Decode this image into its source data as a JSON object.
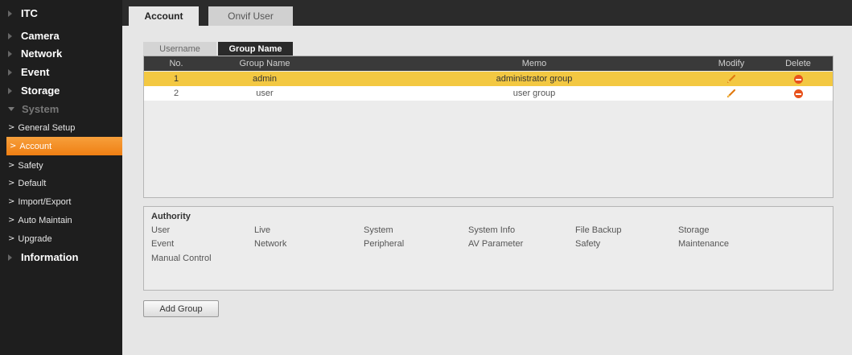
{
  "sidebar": {
    "items": [
      {
        "label": "ITC",
        "type": "top",
        "expanded": false
      },
      {
        "label": "Camera",
        "type": "top",
        "expanded": false
      },
      {
        "label": "Network",
        "type": "top",
        "expanded": false
      },
      {
        "label": "Event",
        "type": "top",
        "expanded": false
      },
      {
        "label": "Storage",
        "type": "top",
        "expanded": false
      },
      {
        "label": "System",
        "type": "top",
        "expanded": true
      },
      {
        "label": "General Setup",
        "type": "sub"
      },
      {
        "label": "Account",
        "type": "sub",
        "active": true
      },
      {
        "label": "Safety",
        "type": "sub"
      },
      {
        "label": "Default",
        "type": "sub"
      },
      {
        "label": "Import/Export",
        "type": "sub"
      },
      {
        "label": "Auto Maintain",
        "type": "sub"
      },
      {
        "label": "Upgrade",
        "type": "sub"
      },
      {
        "label": "Information",
        "type": "top",
        "expanded": false
      }
    ]
  },
  "tabs": {
    "account": "Account",
    "onvif": "Onvif User"
  },
  "subtabs": {
    "username": "Username",
    "group_name": "Group Name"
  },
  "table": {
    "headers": {
      "no": "No.",
      "group_name": "Group Name",
      "memo": "Memo",
      "modify": "Modify",
      "delete": "Delete"
    },
    "rows": [
      {
        "no": "1",
        "group_name": "admin",
        "memo": "administrator group",
        "selected": true
      },
      {
        "no": "2",
        "group_name": "user",
        "memo": "user group",
        "selected": false
      }
    ]
  },
  "authority": {
    "title": "Authority",
    "permissions": [
      [
        "User",
        "Live",
        "System",
        "System Info",
        "File Backup",
        "Storage"
      ],
      [
        "Event",
        "Network",
        "Peripheral",
        "AV Parameter",
        "Safety",
        "Maintenance"
      ],
      [
        "Manual Control"
      ]
    ]
  },
  "buttons": {
    "add_group": "Add Group"
  },
  "colors": {
    "accent_orange": "#f39025",
    "selected_row": "#f3c842",
    "delete_red": "#e8521c"
  },
  "icons": {
    "modify": "pencil-icon",
    "delete": "delete-icon",
    "collapsed_menu": "triangle-right-icon",
    "expanded_menu": "triangle-down-icon",
    "submenu": "chevron-right-icon"
  }
}
